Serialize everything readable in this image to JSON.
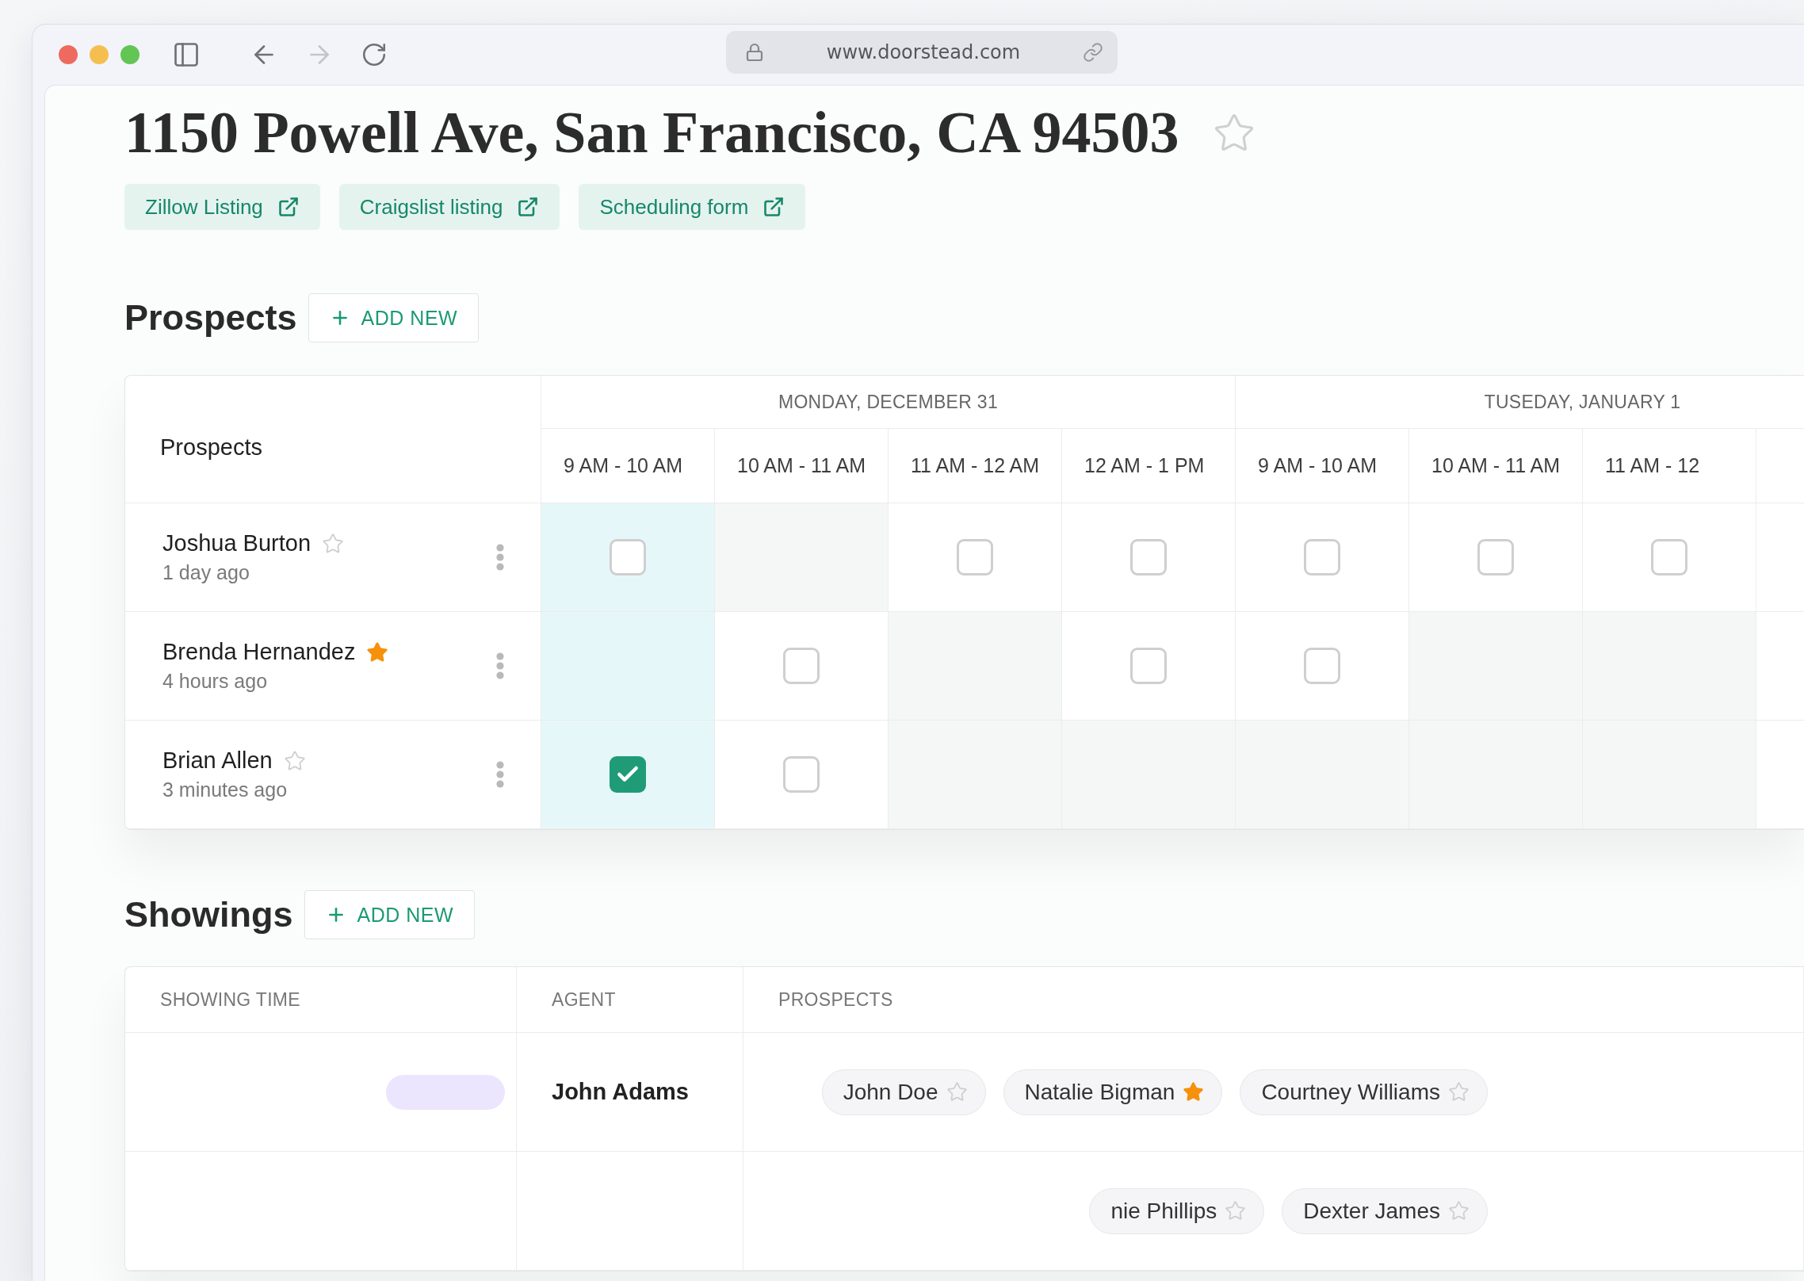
{
  "browser": {
    "url": "www.doorstead.com",
    "can_go_back": true,
    "can_go_forward": false
  },
  "listing": {
    "title": "1150 Powell Ave, San Francisco, CA 94503",
    "starred": false,
    "links": [
      {
        "label": "Zillow Listing"
      },
      {
        "label": "Craigslist listing"
      },
      {
        "label": "Scheduling form"
      }
    ]
  },
  "prospects": {
    "heading": "Prospects",
    "add_button": "ADD NEW",
    "table": {
      "header": "Prospects",
      "days": [
        {
          "label": "MONDAY, DECEMBER 31",
          "slots": [
            {
              "label": "9 AM - 10 AM",
              "highlighted": true
            },
            {
              "label": "10 AM - 11 AM",
              "highlighted": false
            },
            {
              "label": "11 AM - 12 AM",
              "highlighted": false
            },
            {
              "label": "12 AM - 1 PM",
              "highlighted": false
            }
          ]
        },
        {
          "label": "TUSEDAY, JANUARY 1",
          "slots": [
            {
              "label": "9 AM - 10 AM",
              "highlighted": false
            },
            {
              "label": "10 AM - 11 AM",
              "highlighted": false
            },
            {
              "label": "11 AM - 12",
              "highlighted": false
            }
          ]
        }
      ],
      "rows": [
        {
          "name": "Joshua Burton",
          "time": "1 day ago",
          "starred": false,
          "cells": [
            {
              "kind": "open",
              "checked": false
            },
            {
              "kind": "blocked"
            },
            {
              "kind": "open",
              "checked": false
            },
            {
              "kind": "open",
              "checked": false
            },
            {
              "kind": "open",
              "checked": false
            },
            {
              "kind": "open",
              "checked": false
            },
            {
              "kind": "open",
              "checked": false
            }
          ]
        },
        {
          "name": "Brenda Hernandez",
          "time": "4 hours ago",
          "starred": true,
          "cells": [
            {
              "kind": "blocked"
            },
            {
              "kind": "open",
              "checked": false
            },
            {
              "kind": "blocked"
            },
            {
              "kind": "open",
              "checked": false
            },
            {
              "kind": "open",
              "checked": false
            },
            {
              "kind": "blocked"
            },
            {
              "kind": "blocked"
            }
          ]
        },
        {
          "name": "Brian Allen",
          "time": "3 minutes ago",
          "starred": false,
          "cells": [
            {
              "kind": "open",
              "checked": true
            },
            {
              "kind": "open",
              "checked": false
            },
            {
              "kind": "blocked"
            },
            {
              "kind": "blocked"
            },
            {
              "kind": "blocked"
            },
            {
              "kind": "blocked"
            },
            {
              "kind": "blocked"
            }
          ]
        }
      ]
    }
  },
  "showings": {
    "heading": "Showings",
    "add_button": "ADD NEW",
    "columns": [
      "SHOWING TIME",
      "AGENT",
      "PROSPECTS"
    ],
    "rows": [
      {
        "has_badge": true,
        "agent": "John Adams",
        "prospects": [
          {
            "name": "John Doe",
            "starred": false
          },
          {
            "name": "Natalie Bigman",
            "starred": true
          },
          {
            "name": "Courtney Williams",
            "starred": false
          }
        ]
      },
      {
        "prospects": [
          {
            "name": "nie Phillips",
            "starred": false
          },
          {
            "name": "Dexter James",
            "starred": false
          }
        ]
      }
    ]
  }
}
